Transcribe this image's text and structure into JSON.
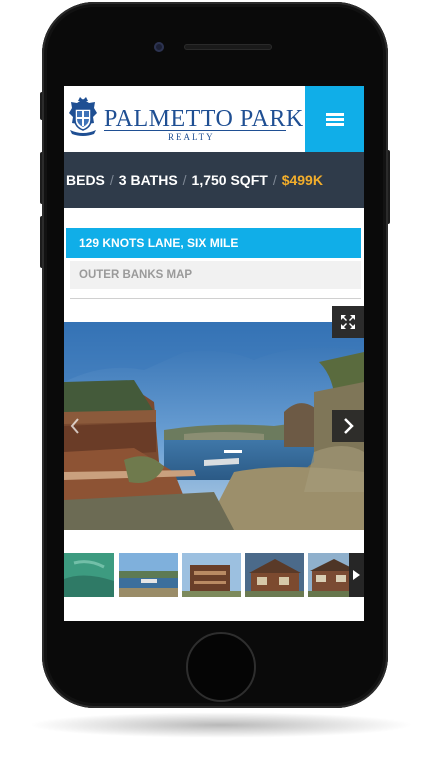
{
  "brand": {
    "name": "PALMETTO PARK",
    "sub": "REALTY",
    "crest_icon": "crest-logo-icon"
  },
  "nav": {
    "menu_icon": "hamburger-menu-icon"
  },
  "stats": {
    "beds": "BEDS",
    "baths": "3 BATHS",
    "sqft": "1,750 SQFT",
    "price": "$499K",
    "separator": "/"
  },
  "listing": {
    "address": "129 KNOTS LANE, SIX MILE",
    "map_link": "OUTER BANKS MAP"
  },
  "gallery": {
    "fullscreen_icon": "expand-arrows-icon",
    "prev_icon": "chevron-left-icon",
    "next_icon": "chevron-right-icon",
    "thumb_next_icon": "play-triangle-icon",
    "thumbnails": [
      "lake-aerial",
      "lake-dock",
      "deck-view",
      "house-front",
      "house-back"
    ]
  },
  "colors": {
    "accent": "#10aee8",
    "stats_bg": "#2f3b4a",
    "price": "#f3ae2b",
    "brand": "#1f4f93"
  }
}
